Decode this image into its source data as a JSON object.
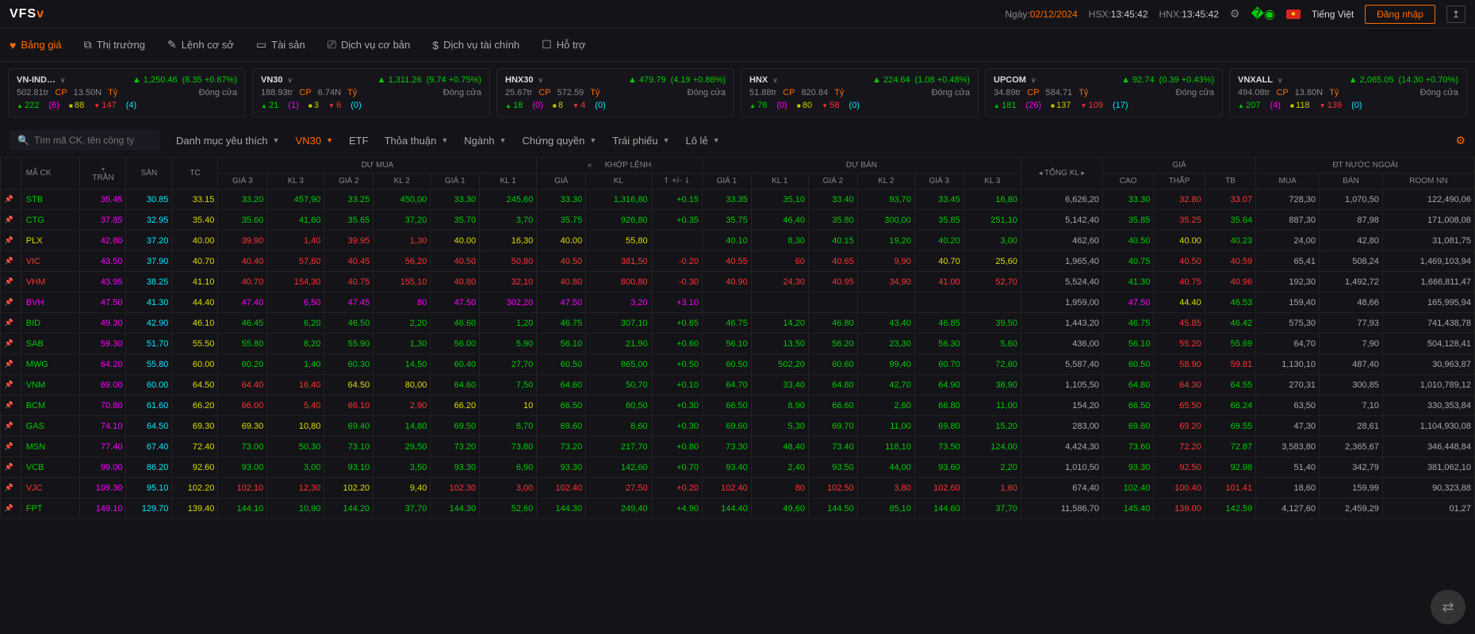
{
  "header": {
    "logo_main": "VFS",
    "date_label": "Ngày:",
    "date": "02/12/2024",
    "hsx_label": "HSX:",
    "hsx_time": "13:45:42",
    "hnx_label": "HNX:",
    "hnx_time": "13:45:42",
    "language": "Tiếng Việt",
    "login": "Đăng nhập"
  },
  "nav": {
    "bang_gia": "Bảng giá",
    "thi_truong": "Thị trường",
    "lenh_co_so": "Lệnh cơ sở",
    "tai_san": "Tài sản",
    "dich_vu_co_ban": "Dịch vụ cơ bản",
    "dich_vu_tai_chinh": "Dịch vụ tài chính",
    "ho_tro": "Hỗ trợ"
  },
  "indices": [
    {
      "name": "VN-IND…",
      "val": "1,250.46",
      "chg": "(8.35 +0.67%)",
      "vol": "502.81tr",
      "cp": "CP",
      "amt": "13.50N",
      "ty": "Tỷ",
      "status": "Đóng cửa",
      "up": "222",
      "up2": "(6)",
      "flat": "88",
      "down": "147",
      "down2": "(4)"
    },
    {
      "name": "VN30",
      "val": "1,311.26",
      "chg": "(9.74 +0.75%)",
      "vol": "188.93tr",
      "cp": "CP",
      "amt": "6.74N",
      "ty": "Tỷ",
      "status": "Đóng cửa",
      "up": "21",
      "up2": "(1)",
      "flat": "3",
      "down": "6",
      "down2": "(0)"
    },
    {
      "name": "HNX30",
      "val": "479.79",
      "chg": "(4.19 +0.88%)",
      "vol": "25.67tr",
      "cp": "CP",
      "amt": "572.59",
      "ty": "Tỷ",
      "status": "Đóng cửa",
      "up": "18",
      "up2": "(0)",
      "flat": "8",
      "down": "4",
      "down2": "(0)"
    },
    {
      "name": "HNX",
      "val": "224.64",
      "chg": "(1.08 +0.48%)",
      "vol": "51.88tr",
      "cp": "CP",
      "amt": "820.84",
      "ty": "Tỷ",
      "status": "Đóng cửa",
      "up": "78",
      "up2": "(0)",
      "flat": "80",
      "down": "58",
      "down2": "(0)"
    },
    {
      "name": "UPCOM",
      "val": "92.74",
      "chg": "(0.39 +0.43%)",
      "vol": "34.89tr",
      "cp": "CP",
      "amt": "584.71",
      "ty": "Tỷ",
      "status": "Đóng cửa",
      "up": "181",
      "up2": "(26)",
      "flat": "137",
      "down": "109",
      "down2": "(17)"
    },
    {
      "name": "VNXALL",
      "val": "2,065.05",
      "chg": "(14.30 +0.70%)",
      "vol": "494.08tr",
      "cp": "CP",
      "amt": "13.80N",
      "ty": "Tỷ",
      "status": "Đóng cửa",
      "up": "207",
      "up2": "(4)",
      "flat": "118",
      "down": "139",
      "down2": "(0)"
    }
  ],
  "search": {
    "placeholder": "Tìm mã CK, tên công ty"
  },
  "filters": {
    "fav": "Danh mục yêu thích",
    "vn30": "VN30",
    "etf": "ETF",
    "thoa_thuan": "Thỏa thuận",
    "nganh": "Ngành",
    "chung_quyen": "Chứng quyền",
    "trai_phieu": "Trái phiếu",
    "lo_le": "Lô lẻ"
  },
  "cols": {
    "ma_ck": "MÃ CK",
    "tran": "TRẦN",
    "san": "SÀN",
    "tc": "TC",
    "du_mua": "DƯ MUA",
    "khop_lenh": "KHỚP LỆNH",
    "du_ban": "DỰ BÁN",
    "tong_kl": "TỔNG KL",
    "gia": "GIÁ",
    "dt_nn": "ĐT NƯỚC NGOÀI",
    "g3": "GIÁ 3",
    "k3": "KL 3",
    "g2": "GIÁ 2",
    "k2": "KL 2",
    "g1": "GIÁ 1",
    "k1": "KL 1",
    "kgia": "GIÁ",
    "kl": "KL",
    "pm": "↿ +/- ⇂",
    "cao": "CAO",
    "thap": "THẤP",
    "tb": "TB",
    "mua": "MUA",
    "ban": "BÁN",
    "room": "ROOM NN"
  },
  "rows": [
    {
      "code": "STB",
      "cc": "c-green",
      "tran": "35.45",
      "san": "30.85",
      "tc": "33.15",
      "bg3": "33.20",
      "bk3": "457,90",
      "bg2": "33.25",
      "bk2": "450,00",
      "bg1": "33.30",
      "bk1": "245,60",
      "kg": "33.30",
      "kl": "1,316,80",
      "pm": "+0.15",
      "ag1": "33.35",
      "ak1": "35,10",
      "ag2": "33.40",
      "ak2": "93,70",
      "ag3": "33.45",
      "ak3": "16,80",
      "tkl": "6,626,20",
      "cao": "33.30",
      "caoc": "c-green",
      "thap": "32.80",
      "thapc": "c-red",
      "tb": "33.07",
      "tbc": "c-red",
      "mua": "728,30",
      "ban": "1,070,50",
      "room": "122,490,06"
    },
    {
      "code": "CTG",
      "cc": "c-green",
      "tran": "37.85",
      "san": "32.95",
      "tc": "35.40",
      "bg3": "35.60",
      "bk3": "41,60",
      "bg2": "35.65",
      "bk2": "37,20",
      "bg1": "35.70",
      "bk1": "3,70",
      "kg": "35.75",
      "kl": "926,80",
      "pm": "+0.35",
      "ag1": "35.75",
      "ak1": "46,40",
      "ag2": "35.80",
      "ak2": "300,00",
      "ag3": "35.85",
      "ak3": "251,10",
      "tkl": "5,142,40",
      "cao": "35.85",
      "caoc": "c-green",
      "thap": "35.25",
      "thapc": "c-red",
      "tb": "35.64",
      "tbc": "c-green",
      "mua": "887,30",
      "ban": "87,98",
      "room": "171,008,08"
    },
    {
      "code": "PLX",
      "cc": "c-yellow",
      "tran": "42.80",
      "san": "37.20",
      "tc": "40.00",
      "bg3": "39.90",
      "bg3c": "c-red",
      "bk3": "1,40",
      "bk3c": "c-red",
      "bg2": "39.95",
      "bg2c": "c-red",
      "bk2": "1,30",
      "bk2c": "c-red",
      "bg1": "40.00",
      "bg1c": "c-yellow",
      "bk1": "16,30",
      "bk1c": "c-yellow",
      "kg": "40.00",
      "kgc": "c-yellow",
      "kl": "55,80",
      "klc": "c-yellow",
      "pm": "",
      "pmc": "",
      "ag1": "40.10",
      "ak1": "8,30",
      "ag2": "40.15",
      "ak2": "19,20",
      "ag3": "40.20",
      "ak3": "3,00",
      "tkl": "462,60",
      "cao": "40.50",
      "caoc": "c-green",
      "thap": "40.00",
      "thapc": "c-yellow",
      "tb": "40.23",
      "tbc": "c-green",
      "mua": "24,00",
      "ban": "42,80",
      "room": "31,081,75"
    },
    {
      "code": "VIC",
      "cc": "c-red",
      "tran": "43.50",
      "san": "37.90",
      "tc": "40.70",
      "bg3": "40.40",
      "bg3c": "c-red",
      "bk3": "57,80",
      "bk3c": "c-red",
      "bg2": "40.45",
      "bg2c": "c-red",
      "bk2": "56,20",
      "bk2c": "c-red",
      "bg1": "40.50",
      "bg1c": "c-red",
      "bk1": "50,80",
      "bk1c": "c-red",
      "kg": "40.50",
      "kgc": "c-red",
      "kl": "381,50",
      "klc": "c-red",
      "pm": "-0.20",
      "pmc": "c-red",
      "ag1": "40.55",
      "ag1c": "c-red",
      "ak1": "60",
      "ak1c": "c-red",
      "ag2": "40.65",
      "ag2c": "c-red",
      "ak2": "9,90",
      "ak2c": "c-red",
      "ag3": "40.70",
      "ag3c": "c-yellow",
      "ak3": "25,60",
      "ak3c": "c-yellow",
      "tkl": "1,965,40",
      "cao": "40.75",
      "caoc": "c-green",
      "thap": "40.50",
      "thapc": "c-red",
      "tb": "40.59",
      "tbc": "c-red",
      "mua": "65,41",
      "ban": "508,24",
      "room": "1,469,103,94"
    },
    {
      "code": "VHM",
      "cc": "c-red",
      "tran": "43.95",
      "san": "38.25",
      "tc": "41.10",
      "bg3": "40.70",
      "bg3c": "c-red",
      "bk3": "154,30",
      "bk3c": "c-red",
      "bg2": "40.75",
      "bg2c": "c-red",
      "bk2": "155,10",
      "bk2c": "c-red",
      "bg1": "40.80",
      "bg1c": "c-red",
      "bk1": "32,10",
      "bk1c": "c-red",
      "kg": "40.80",
      "kgc": "c-red",
      "kl": "800,80",
      "klc": "c-red",
      "pm": "-0.30",
      "pmc": "c-red",
      "ag1": "40.90",
      "ag1c": "c-red",
      "ak1": "24,30",
      "ak1c": "c-red",
      "ag2": "40.95",
      "ag2c": "c-red",
      "ak2": "34,90",
      "ak2c": "c-red",
      "ag3": "41.00",
      "ag3c": "c-red",
      "ak3": "52,70",
      "ak3c": "c-red",
      "tkl": "5,524,40",
      "cao": "41.30",
      "caoc": "c-green",
      "thap": "40.75",
      "thapc": "c-red",
      "tb": "40.96",
      "tbc": "c-red",
      "mua": "192,30",
      "ban": "1,492,72",
      "room": "1,666,811,47"
    },
    {
      "code": "BVH",
      "cc": "c-mag",
      "tran": "47.50",
      "san": "41.30",
      "tc": "44.40",
      "bg3": "47.40",
      "bk3": "6,50",
      "bg2": "47.45",
      "bk2": "80",
      "bg1": "47.50",
      "bg1c": "c-mag",
      "bk1": "302,20",
      "bk1c": "c-mag",
      "kg": "47.50",
      "kgc": "c-mag",
      "kl": "3,20",
      "klc": "c-mag",
      "pm": "+3.10",
      "pmc": "c-mag",
      "ag1": "",
      "ak1": "",
      "ag2": "",
      "ak2": "",
      "ag3": "",
      "ak3": "",
      "tkl": "1,959,00",
      "cao": "47.50",
      "caoc": "c-mag",
      "thap": "44.40",
      "thapc": "c-yellow",
      "tb": "46.53",
      "tbc": "c-green",
      "mua": "159,40",
      "ban": "48,66",
      "room": "165,995,94"
    },
    {
      "code": "BID",
      "cc": "c-green",
      "tran": "49.30",
      "san": "42.90",
      "tc": "46.10",
      "bg3": "46.45",
      "bk3": "6,20",
      "bg2": "46.50",
      "bk2": "2,20",
      "bg1": "46.60",
      "bk1": "1,20",
      "kg": "46.75",
      "kl": "307,10",
      "pm": "+0.65",
      "ag1": "46.75",
      "ak1": "14,20",
      "ag2": "46.80",
      "ak2": "43,40",
      "ag3": "46.85",
      "ak3": "39,50",
      "tkl": "1,443,20",
      "cao": "46.75",
      "caoc": "c-green",
      "thap": "45.85",
      "thapc": "c-red",
      "tb": "46.42",
      "tbc": "c-green",
      "mua": "575,30",
      "ban": "77,93",
      "room": "741,438,78"
    },
    {
      "code": "SAB",
      "cc": "c-green",
      "tran": "59.30",
      "san": "51.70",
      "tc": "55.50",
      "bg3": "55.80",
      "bk3": "8,20",
      "bg2": "55.90",
      "bk2": "1,30",
      "bg1": "56.00",
      "bk1": "5,90",
      "kg": "56.10",
      "kl": "21,90",
      "pm": "+0.60",
      "ag1": "56.10",
      "ak1": "13,50",
      "ag2": "56.20",
      "ak2": "23,30",
      "ag3": "56.30",
      "ak3": "5,60",
      "tkl": "436,00",
      "cao": "56.10",
      "caoc": "c-green",
      "thap": "55.20",
      "thapc": "c-red",
      "tb": "55.69",
      "tbc": "c-green",
      "mua": "64,70",
      "ban": "7,90",
      "room": "504,128,41"
    },
    {
      "code": "MWG",
      "cc": "c-green",
      "tran": "64.20",
      "san": "55.80",
      "tc": "60.00",
      "bg3": "60.20",
      "bk3": "1,40",
      "bg2": "60.30",
      "bk2": "14,50",
      "bg1": "60.40",
      "bk1": "27,70",
      "kg": "60.50",
      "kl": "865,00",
      "pm": "+0.50",
      "ag1": "60.50",
      "ak1": "502,20",
      "ag2": "60.60",
      "ak2": "99,40",
      "ag3": "60.70",
      "ak3": "72,60",
      "tkl": "5,587,40",
      "cao": "60.50",
      "caoc": "c-green",
      "thap": "58.90",
      "thapc": "c-red",
      "tb": "59.81",
      "tbc": "c-red",
      "mua": "1,130,10",
      "ban": "487,40",
      "room": "30,963,87"
    },
    {
      "code": "VNM",
      "cc": "c-green",
      "tran": "69.00",
      "san": "60.00",
      "tc": "64.50",
      "bg3": "64.40",
      "bg3c": "c-red",
      "bk3": "16,40",
      "bk3c": "c-red",
      "bg2": "64.50",
      "bg2c": "c-yellow",
      "bk2": "80,00",
      "bk2c": "c-yellow",
      "bg1": "64.60",
      "bk1": "7,50",
      "kg": "64.60",
      "kl": "50,70",
      "pm": "+0.10",
      "ag1": "64.70",
      "ak1": "33,40",
      "ag2": "64.80",
      "ak2": "42,70",
      "ag3": "64.90",
      "ak3": "38,90",
      "tkl": "1,105,50",
      "cao": "64.80",
      "caoc": "c-green",
      "thap": "64.30",
      "thapc": "c-red",
      "tb": "64.55",
      "tbc": "c-green",
      "mua": "270,31",
      "ban": "300,85",
      "room": "1,010,789,12"
    },
    {
      "code": "BCM",
      "cc": "c-green",
      "tran": "70.80",
      "san": "61.60",
      "tc": "66.20",
      "bg3": "66.00",
      "bg3c": "c-red",
      "bk3": "5,40",
      "bk3c": "c-red",
      "bg2": "66.10",
      "bg2c": "c-red",
      "bk2": "2,90",
      "bk2c": "c-red",
      "bg1": "66.20",
      "bg1c": "c-yellow",
      "bk1": "10",
      "bk1c": "c-yellow",
      "kg": "66.50",
      "kl": "60,50",
      "pm": "+0.30",
      "ag1": "66.50",
      "ak1": "8,90",
      "ag2": "66.60",
      "ak2": "2,60",
      "ag3": "66.80",
      "ak3": "11,00",
      "tkl": "154,20",
      "cao": "66.50",
      "caoc": "c-green",
      "thap": "65.50",
      "thapc": "c-red",
      "tb": "66.24",
      "tbc": "c-green",
      "mua": "63,50",
      "ban": "7,10",
      "room": "330,353,84"
    },
    {
      "code": "GAS",
      "cc": "c-green",
      "tran": "74.10",
      "san": "64.50",
      "tc": "69.30",
      "bg3": "69.30",
      "bg3c": "c-yellow",
      "bk3": "10,80",
      "bk3c": "c-yellow",
      "bg2": "69.40",
      "bk2": "14,80",
      "bg1": "69.50",
      "bk1": "8,70",
      "kg": "69.60",
      "kl": "8,60",
      "pm": "+0.30",
      "ag1": "69.60",
      "ak1": "5,30",
      "ag2": "69.70",
      "ak2": "11,00",
      "ag3": "69.80",
      "ak3": "15,20",
      "tkl": "283,00",
      "cao": "69.80",
      "caoc": "c-green",
      "thap": "69.20",
      "thapc": "c-red",
      "tb": "69.55",
      "tbc": "c-green",
      "mua": "47,30",
      "ban": "28,61",
      "room": "1,104,930,08"
    },
    {
      "code": "MSN",
      "cc": "c-green",
      "tran": "77.40",
      "san": "67.40",
      "tc": "72.40",
      "bg3": "73.00",
      "bk3": "50,30",
      "bg2": "73.10",
      "bk2": "29,50",
      "bg1": "73.20",
      "bk1": "73,80",
      "kg": "73.20",
      "kl": "217,70",
      "pm": "+0.80",
      "ag1": "73.30",
      "ak1": "48,40",
      "ag2": "73.40",
      "ak2": "118,10",
      "ag3": "73.50",
      "ak3": "124,00",
      "tkl": "4,424,30",
      "cao": "73.60",
      "caoc": "c-green",
      "thap": "72.20",
      "thapc": "c-red",
      "tb": "72.87",
      "tbc": "c-green",
      "mua": "3,583,80",
      "ban": "2,365,67",
      "room": "346,448,84"
    },
    {
      "code": "VCB",
      "cc": "c-green",
      "tran": "99.00",
      "san": "86.20",
      "tc": "92.60",
      "bg3": "93.00",
      "bk3": "3,00",
      "bg2": "93.10",
      "bk2": "3,50",
      "bg1": "93.30",
      "bk1": "6,90",
      "kg": "93.30",
      "kl": "142,60",
      "pm": "+0.70",
      "ag1": "93.40",
      "ak1": "2,40",
      "ag2": "93.50",
      "ak2": "44,00",
      "ag3": "93.60",
      "ak3": "2,20",
      "tkl": "1,010,50",
      "cao": "93.30",
      "caoc": "c-green",
      "thap": "92.50",
      "thapc": "c-red",
      "tb": "92.98",
      "tbc": "c-green",
      "mua": "51,40",
      "ban": "342,79",
      "room": "381,062,10"
    },
    {
      "code": "VJC",
      "cc": "c-red",
      "tran": "109.30",
      "san": "95.10",
      "tc": "102.20",
      "bg3": "102.10",
      "bg3c": "c-red",
      "bk3": "12,30",
      "bk3c": "c-red",
      "bg2": "102.20",
      "bg2c": "c-yellow",
      "bk2": "9,40",
      "bk2c": "c-yellow",
      "bg1": "102.30",
      "bk1": "3,00",
      "kg": "102.40",
      "kl": "27,50",
      "pm": "+0.20",
      "ag1": "102.40",
      "ak1": "80",
      "ag2": "102.50",
      "ak2": "3,80",
      "ag3": "102.60",
      "ak3": "1,60",
      "tkl": "674,40",
      "cao": "102.40",
      "caoc": "c-green",
      "thap": "100.40",
      "thapc": "c-red",
      "tb": "101.41",
      "tbc": "c-red",
      "mua": "18,60",
      "ban": "159,99",
      "room": "90,323,88"
    },
    {
      "code": "FPT",
      "cc": "c-green",
      "tran": "149.10",
      "san": "129.70",
      "tc": "139.40",
      "bg3": "144.10",
      "bk3": "10,90",
      "bg2": "144.20",
      "bk2": "37,70",
      "bg1": "144.30",
      "bk1": "52,60",
      "kg": "144.30",
      "kl": "249,40",
      "pm": "+4.90",
      "ag1": "144.40",
      "ak1": "49,60",
      "ag2": "144.50",
      "ak2": "85,10",
      "ag3": "144.60",
      "ak3": "37,70",
      "tkl": "11,586,70",
      "cao": "145.40",
      "caoc": "c-green",
      "thap": "139.00",
      "thapc": "c-red",
      "tb": "142.59",
      "tbc": "c-green",
      "mua": "4,127,60",
      "ban": "2,459,29",
      "room": "01,27"
    }
  ]
}
